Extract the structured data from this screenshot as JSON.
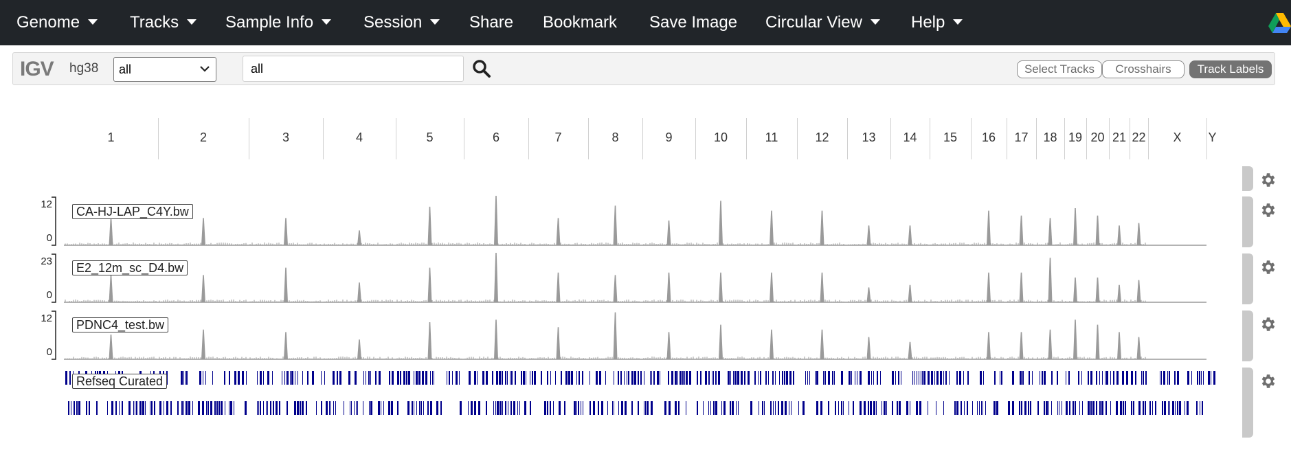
{
  "navbar": {
    "items": [
      {
        "label": "Genome",
        "dropdown": true
      },
      {
        "label": "Tracks",
        "dropdown": true
      },
      {
        "label": "Sample Info",
        "dropdown": true
      },
      {
        "label": "Session",
        "dropdown": true
      },
      {
        "label": "Share",
        "dropdown": false
      },
      {
        "label": "Bookmark",
        "dropdown": false
      },
      {
        "label": "Save Image",
        "dropdown": false
      },
      {
        "label": "Circular View",
        "dropdown": true
      },
      {
        "label": "Help",
        "dropdown": true
      }
    ],
    "right_icon": "google-drive-icon"
  },
  "controls": {
    "logo": "IGV",
    "genome": "hg38",
    "chromosome_select": "all",
    "locus_value": "all",
    "search_icon": "search-icon",
    "buttons": {
      "select_tracks": "Select Tracks",
      "crosshairs": "Crosshairs",
      "track_labels": "Track Labels"
    }
  },
  "chromosomes": [
    "1",
    "2",
    "3",
    "4",
    "5",
    "6",
    "7",
    "8",
    "9",
    "10",
    "11",
    "12",
    "13",
    "14",
    "15",
    "16",
    "17",
    "18",
    "19",
    "20",
    "21",
    "22",
    "X",
    "Y"
  ],
  "tracks": [
    {
      "name": "CA-HJ-LAP_C4Y.bw",
      "data_range": {
        "max": "12",
        "min": "0"
      }
    },
    {
      "name": "E2_12m_sc_D4.bw",
      "data_range": {
        "max": "23",
        "min": "0"
      }
    },
    {
      "name": "PDNC4_test.bw",
      "data_range": {
        "max": "12",
        "min": "0"
      }
    },
    {
      "name": "Refseq Curated",
      "type": "annotation"
    }
  ],
  "colors": {
    "navbar_bg": "#212529",
    "wig_gray": "#9a9a9a",
    "feature_blue": "#00008b",
    "active_button": "#737373"
  }
}
